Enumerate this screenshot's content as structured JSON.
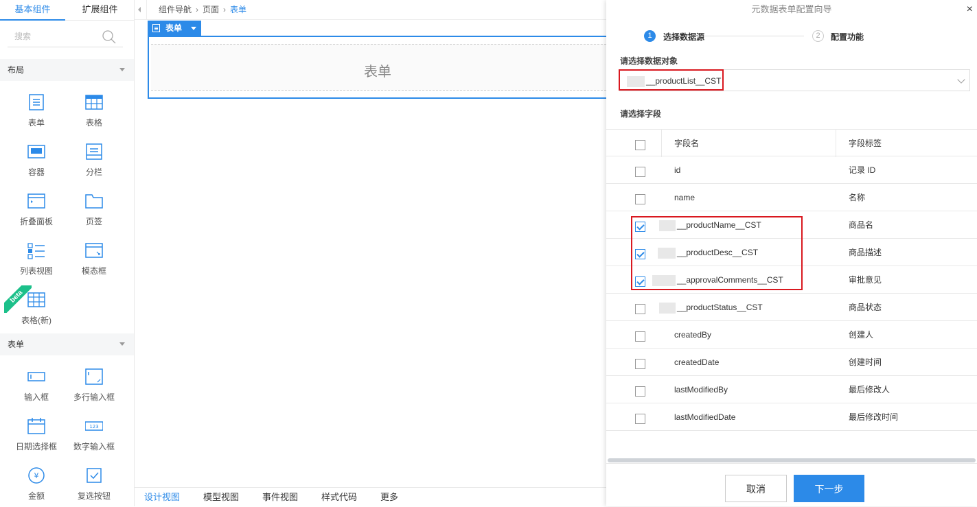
{
  "left_panel": {
    "tabs": [
      "基本组件",
      "扩展组件"
    ],
    "search_placeholder": "搜索",
    "sections": [
      "布局",
      "表单"
    ],
    "layout_items": [
      "表单",
      "表格",
      "容器",
      "分栏",
      "折叠面板",
      "页签",
      "列表视图",
      "模态框",
      "表格(新)"
    ],
    "form_items": [
      "输入框",
      "多行输入框",
      "日期选择框",
      "数字输入框",
      "金额",
      "复选按钮"
    ],
    "beta_badge": "beta"
  },
  "breadcrumb": [
    "组件导航",
    "页面",
    "表单"
  ],
  "canvas": {
    "form_tag": "表单",
    "form_placeholder": "表单"
  },
  "bottom_tabs": [
    "设计视图",
    "模型视图",
    "事件视图",
    "样式代码",
    "更多"
  ],
  "dialog": {
    "title": "元数据表单配置向导",
    "close": "×",
    "steps": [
      {
        "num": "1",
        "label": "选择数据源"
      },
      {
        "num": "2",
        "label": "配置功能"
      }
    ],
    "object_label": "请选择数据对象",
    "object_value": "__productList__CST",
    "field_label": "请选择字段",
    "columns": [
      "字段名",
      "字段标签"
    ],
    "fields": [
      {
        "name": "id",
        "label": "记录 ID",
        "checked": false
      },
      {
        "name": "name",
        "label": "名称",
        "checked": false
      },
      {
        "name": "__productName__CST",
        "label": "商品名",
        "checked": true
      },
      {
        "name": "__productDesc__CST",
        "label": "商品描述",
        "checked": true
      },
      {
        "name": "__approvalComments__CST",
        "label": "审批意见",
        "checked": true
      },
      {
        "name": "__productStatus__CST",
        "label": "商品状态",
        "checked": false
      },
      {
        "name": "createdBy",
        "label": "创建人",
        "checked": false
      },
      {
        "name": "createdDate",
        "label": "创建时间",
        "checked": false
      },
      {
        "name": "lastModifiedBy",
        "label": "最后修改人",
        "checked": false
      },
      {
        "name": "lastModifiedDate",
        "label": "最后修改时间",
        "checked": false
      }
    ],
    "cancel_label": "取消",
    "next_label": "下一步"
  },
  "colors": {
    "accent": "#2c8ae8",
    "highlight": "#d9181f",
    "beta": "#1cc08a"
  }
}
